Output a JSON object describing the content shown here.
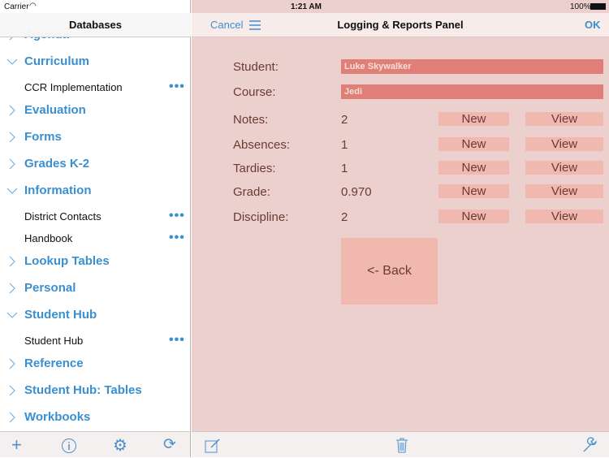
{
  "status": {
    "carrier": "Carrier",
    "time": "1:21 AM",
    "battery": "100%"
  },
  "sidebar": {
    "title": "Databases",
    "items": [
      {
        "label": "Agenda",
        "expanded": false
      },
      {
        "label": "Curriculum",
        "expanded": true
      },
      {
        "sub": "CCR Implementation"
      },
      {
        "label": "Evaluation",
        "expanded": false
      },
      {
        "label": "Forms",
        "expanded": false
      },
      {
        "label": "Grades K-2",
        "expanded": false
      },
      {
        "label": "Information",
        "expanded": true
      },
      {
        "sub": "District Contacts"
      },
      {
        "sub": "Handbook"
      },
      {
        "label": "Lookup Tables",
        "expanded": false
      },
      {
        "label": "Personal",
        "expanded": false
      },
      {
        "label": "Student Hub",
        "expanded": true
      },
      {
        "sub": "Student Hub"
      },
      {
        "label": "Reference",
        "expanded": false
      },
      {
        "label": "Student Hub: Tables",
        "expanded": false
      },
      {
        "label": "Workbooks",
        "expanded": false
      }
    ]
  },
  "header": {
    "cancel": "Cancel",
    "title": "Logging & Reports Panel",
    "ok": "OK"
  },
  "form": {
    "student_label": "Student:",
    "student": "Luke Skywalker",
    "course_label": "Course:",
    "course": "Jedi",
    "rows": [
      {
        "label": "Notes:",
        "value": "2",
        "new": "New",
        "view": "View"
      },
      {
        "label": "Absences:",
        "value": "1",
        "new": "New",
        "view": "View"
      },
      {
        "label": "Tardies:",
        "value": "1",
        "new": "New",
        "view": "View"
      },
      {
        "label": "Grade:",
        "value": "0.970",
        "new": "New",
        "view": "View"
      },
      {
        "label": "Discipline:",
        "value": "2",
        "new": "New",
        "view": "View"
      }
    ],
    "back": "<- Back"
  },
  "icons": {
    "dots": "•••",
    "chev_right": "›",
    "chev_down": "⌄"
  }
}
